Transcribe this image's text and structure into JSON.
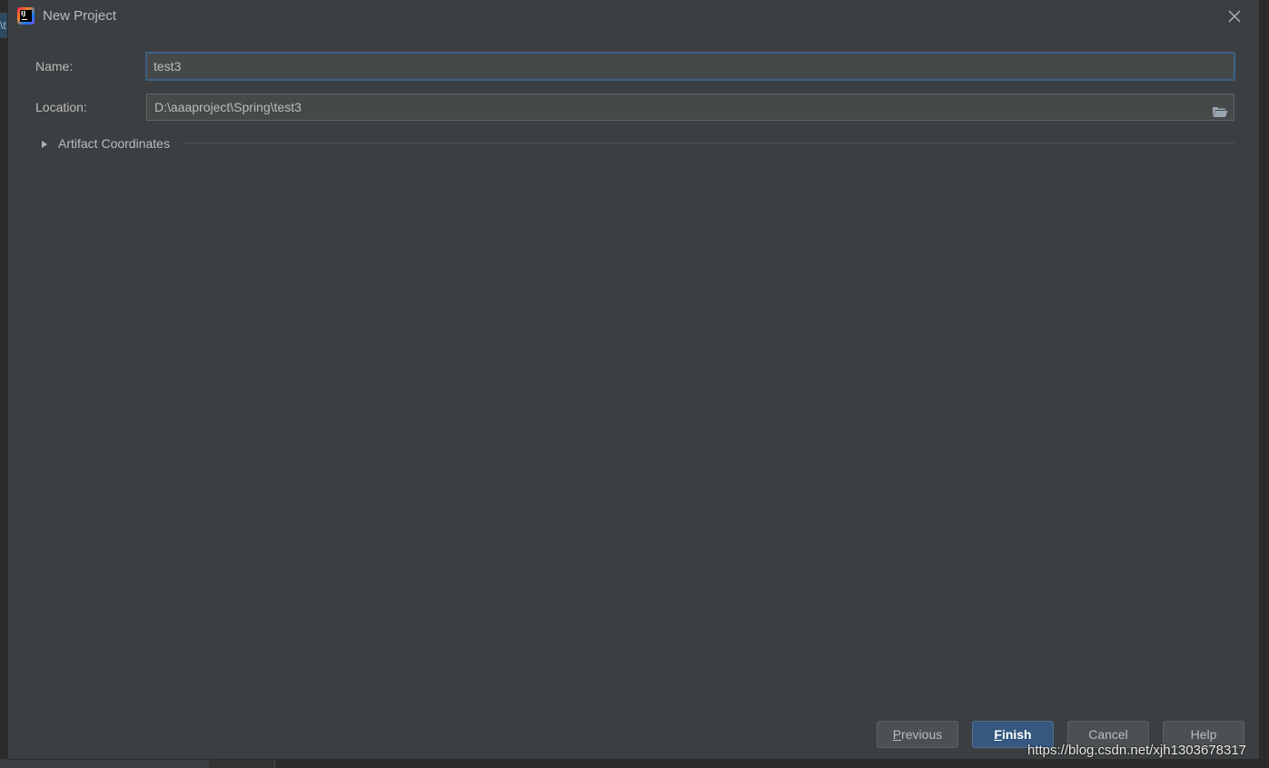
{
  "window": {
    "title": "New Project"
  },
  "background": {
    "tab_text": "\\t"
  },
  "form": {
    "name_label": "Name:",
    "name_value": "test3",
    "location_label": "Location:",
    "location_value": "D:\\aaaproject\\Spring\\test3"
  },
  "artifact_section": {
    "label": "Artifact Coordinates",
    "expanded": false
  },
  "buttons": {
    "previous": {
      "mnemonic": "P",
      "rest": "revious"
    },
    "finish": {
      "mnemonic": "F",
      "rest": "inish"
    },
    "cancel": "Cancel",
    "help": "Help"
  },
  "watermark": "https://blog.csdn.net/xjh1303678317",
  "colors": {
    "dialog_bg": "#3c3f41",
    "input_bg": "#45494a",
    "focus_border": "#3d6185",
    "primary_button": "#365880",
    "text": "#bbbbbb"
  },
  "icons": {
    "app": "intellij-idea-icon",
    "close": "close-icon",
    "folder": "folder-open-icon",
    "expand": "triangle-right-icon"
  }
}
